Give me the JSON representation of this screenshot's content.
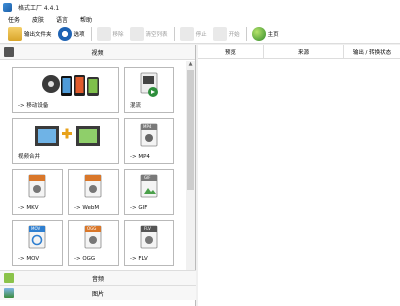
{
  "window": {
    "title": "格式工厂 4.4.1"
  },
  "menu": {
    "items": [
      "任务",
      "皮肤",
      "语言",
      "帮助"
    ]
  },
  "toolbar": {
    "output_folder": "输出文件夹",
    "options": "选项",
    "remove": "移除",
    "clear_list": "清空列表",
    "stop": "停止",
    "start": "开始",
    "home": "主页"
  },
  "left": {
    "video_header": "视频",
    "tiles": [
      {
        "label": "-> 移动设备",
        "icon": "mobile-devices-icon"
      },
      {
        "label": "混流",
        "icon": "mux-icon"
      },
      {
        "label": "视频合并",
        "icon": "video-merge-icon"
      },
      {
        "label": "-> MP4",
        "icon": "mp4-file-icon"
      },
      {
        "label": "-> MKV",
        "icon": "mkv-file-icon"
      },
      {
        "label": "-> WebM",
        "icon": "webm-file-icon"
      },
      {
        "label": "-> GIF",
        "icon": "gif-file-icon"
      },
      {
        "label": "-> MOV",
        "icon": "mov-file-icon"
      },
      {
        "label": "-> OGG",
        "icon": "ogg-file-icon"
      },
      {
        "label": "-> FLV",
        "icon": "flv-file-icon"
      }
    ],
    "file_badges": {
      "mp4": "MP4",
      "gif": "GIF",
      "mov": "MOV",
      "ogg": "OGG",
      "flv": "FLV"
    },
    "audio_header": "音频",
    "image_header": "图片"
  },
  "right": {
    "columns": [
      "预览",
      "来源",
      "输出 / 转换状态"
    ]
  }
}
